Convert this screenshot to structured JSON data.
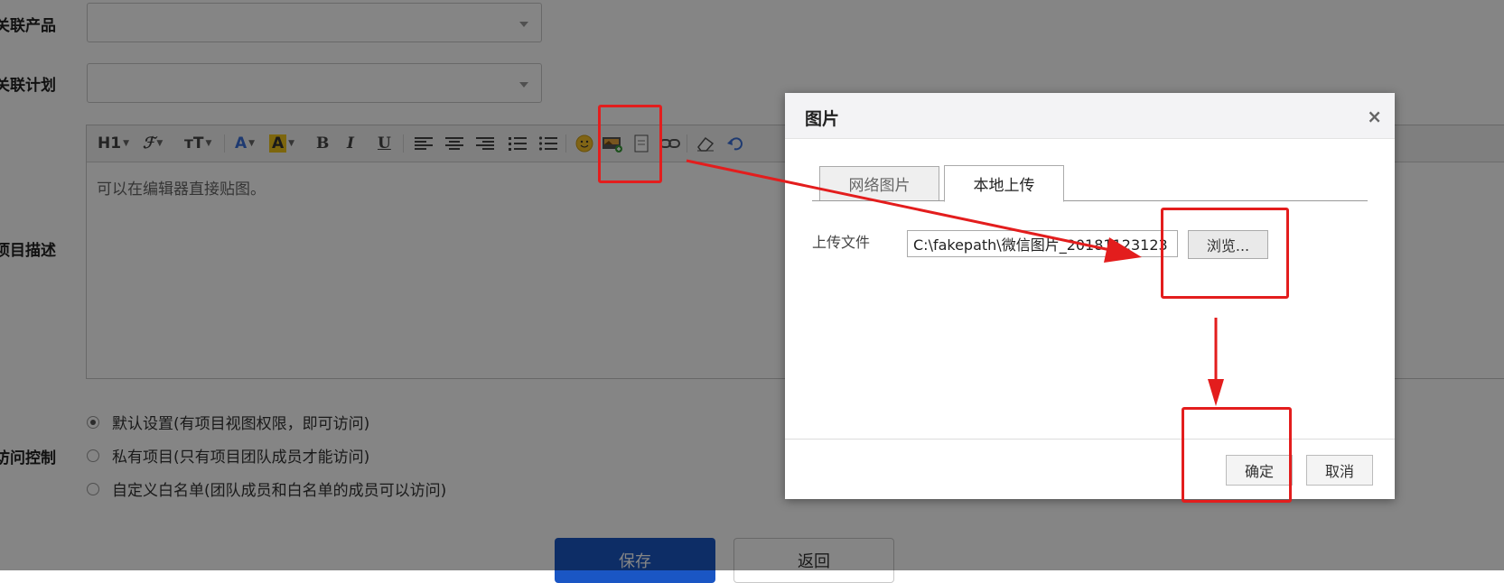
{
  "form": {
    "related_product_label": "关联产品",
    "related_plan_label": "关联计划",
    "description_label": "项目描述",
    "access_label": "访问控制"
  },
  "toolbar": {
    "heading": "H1",
    "font": "ℱ",
    "font_size": "ᴛT",
    "font_color": "A",
    "highlight": "A",
    "bold": "B",
    "italic": "I",
    "underline": "U"
  },
  "editor": {
    "placeholder_text": "可以在编辑器直接贴图。"
  },
  "access": {
    "options": [
      {
        "label": "默认设置(有项目视图权限，即可访问)",
        "checked": true
      },
      {
        "label": "私有项目(只有项目团队成员才能访问)",
        "checked": false
      },
      {
        "label": "自定义白名单(团队成员和白名单的成员可以访问)",
        "checked": false
      }
    ]
  },
  "actions": {
    "save": "保存",
    "back": "返回"
  },
  "dialog": {
    "title": "图片",
    "close": "×",
    "tabs": [
      "网络图片",
      "本地上传"
    ],
    "active_tab": "本地上传",
    "upload_label": "上传文件",
    "file_value": "C:\\fakepath\\微信图片_20181123123",
    "browse": "浏览...",
    "ok": "确定",
    "cancel": "取消"
  },
  "colors": {
    "annotation": "#e31d1d",
    "primary": "#1a56c4"
  }
}
